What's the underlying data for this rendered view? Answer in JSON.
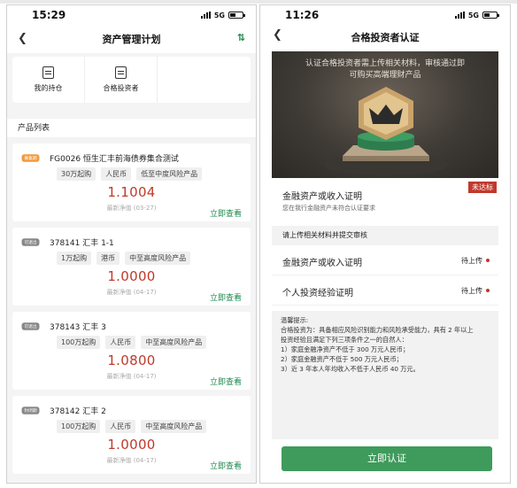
{
  "left_phone": {
    "status_bar": {
      "time": "15:29",
      "network": "5G"
    },
    "header": {
      "back_icon": "chevron-left-icon",
      "title": "资产管理计划",
      "filter_icon": "filter-sliders-icon"
    },
    "shortcuts": [
      {
        "label": "我的持仓",
        "icon": "clipboard-icon"
      },
      {
        "label": "合格投资者",
        "icon": "id-card-icon"
      }
    ],
    "section_title": "产品列表",
    "products": [
      {
        "badge": "募集期",
        "title": "FG0026 恒生汇丰前海债券集合测试",
        "tags": [
          "30万起购",
          "人民币",
          "低至中度风险产品"
        ],
        "nav": "1.1004",
        "nav_label": "最新净值 (03-27)",
        "action": "立即查看"
      },
      {
        "badge": "可退出",
        "title": "378141 汇丰 1-1",
        "tags": [
          "1万起购",
          "港币",
          "中至高度风险产品"
        ],
        "nav": "1.0000",
        "nav_label": "最新净值 (04-17)",
        "action": "立即查看"
      },
      {
        "badge": "可退出",
        "title": "378143 汇丰 3",
        "tags": [
          "100万起购",
          "人民币",
          "中至高度风险产品"
        ],
        "nav": "1.0800",
        "nav_label": "最新净值 (04-17)",
        "action": "立即查看"
      },
      {
        "badge": "封闭期",
        "title": "378142 汇丰 2",
        "tags": [
          "100万起购",
          "人民币",
          "中至高度风险产品"
        ],
        "nav": "1.0000",
        "nav_label": "最新净值 (04-17)",
        "action": "立即查看"
      }
    ],
    "colors": {
      "accent_green": "#1e8a4e",
      "nav_red": "#c0392b",
      "badge_orange": "#f29a3a",
      "badge_gray": "#888888"
    }
  },
  "right_phone": {
    "status_bar": {
      "time": "11:26",
      "network": "5G"
    },
    "header": {
      "back_icon": "chevron-left-icon",
      "title": "合格投资者认证"
    },
    "banner": {
      "line1": "认证合格投资者需上传相关材料，审核通过即",
      "line2": "可购买高端理财产品",
      "icon": "crown-medal-icon"
    },
    "status_section": {
      "title": "金融资产或收入证明",
      "desc": "您在我行金融资产未符合认证要求",
      "flag": "未达标"
    },
    "upload_section_title": "请上传相关材料并提交审核",
    "uploads": [
      {
        "label": "金融资产或收入证明",
        "status": "待上传"
      },
      {
        "label": "个人投资经验证明",
        "status": "待上传"
      }
    ],
    "tips": {
      "heading": "温馨提示:",
      "lines": [
        "合格投资为：具备相应风险识别能力和风险承受能力，具有 2 年以上",
        "投资经验且满足下列三项条件之一的自然人：",
        "1）家庭金融净资产不低于 300 万元人民币；",
        "2）家庭金融资产不低于 500 万元人民币；",
        "3）近 3 年本人年均收入不低于人民币 40 万元。"
      ]
    },
    "cta_label": "立即认证",
    "colors": {
      "cta_green": "#3e9b5c",
      "flag_red": "#c0392b"
    }
  }
}
